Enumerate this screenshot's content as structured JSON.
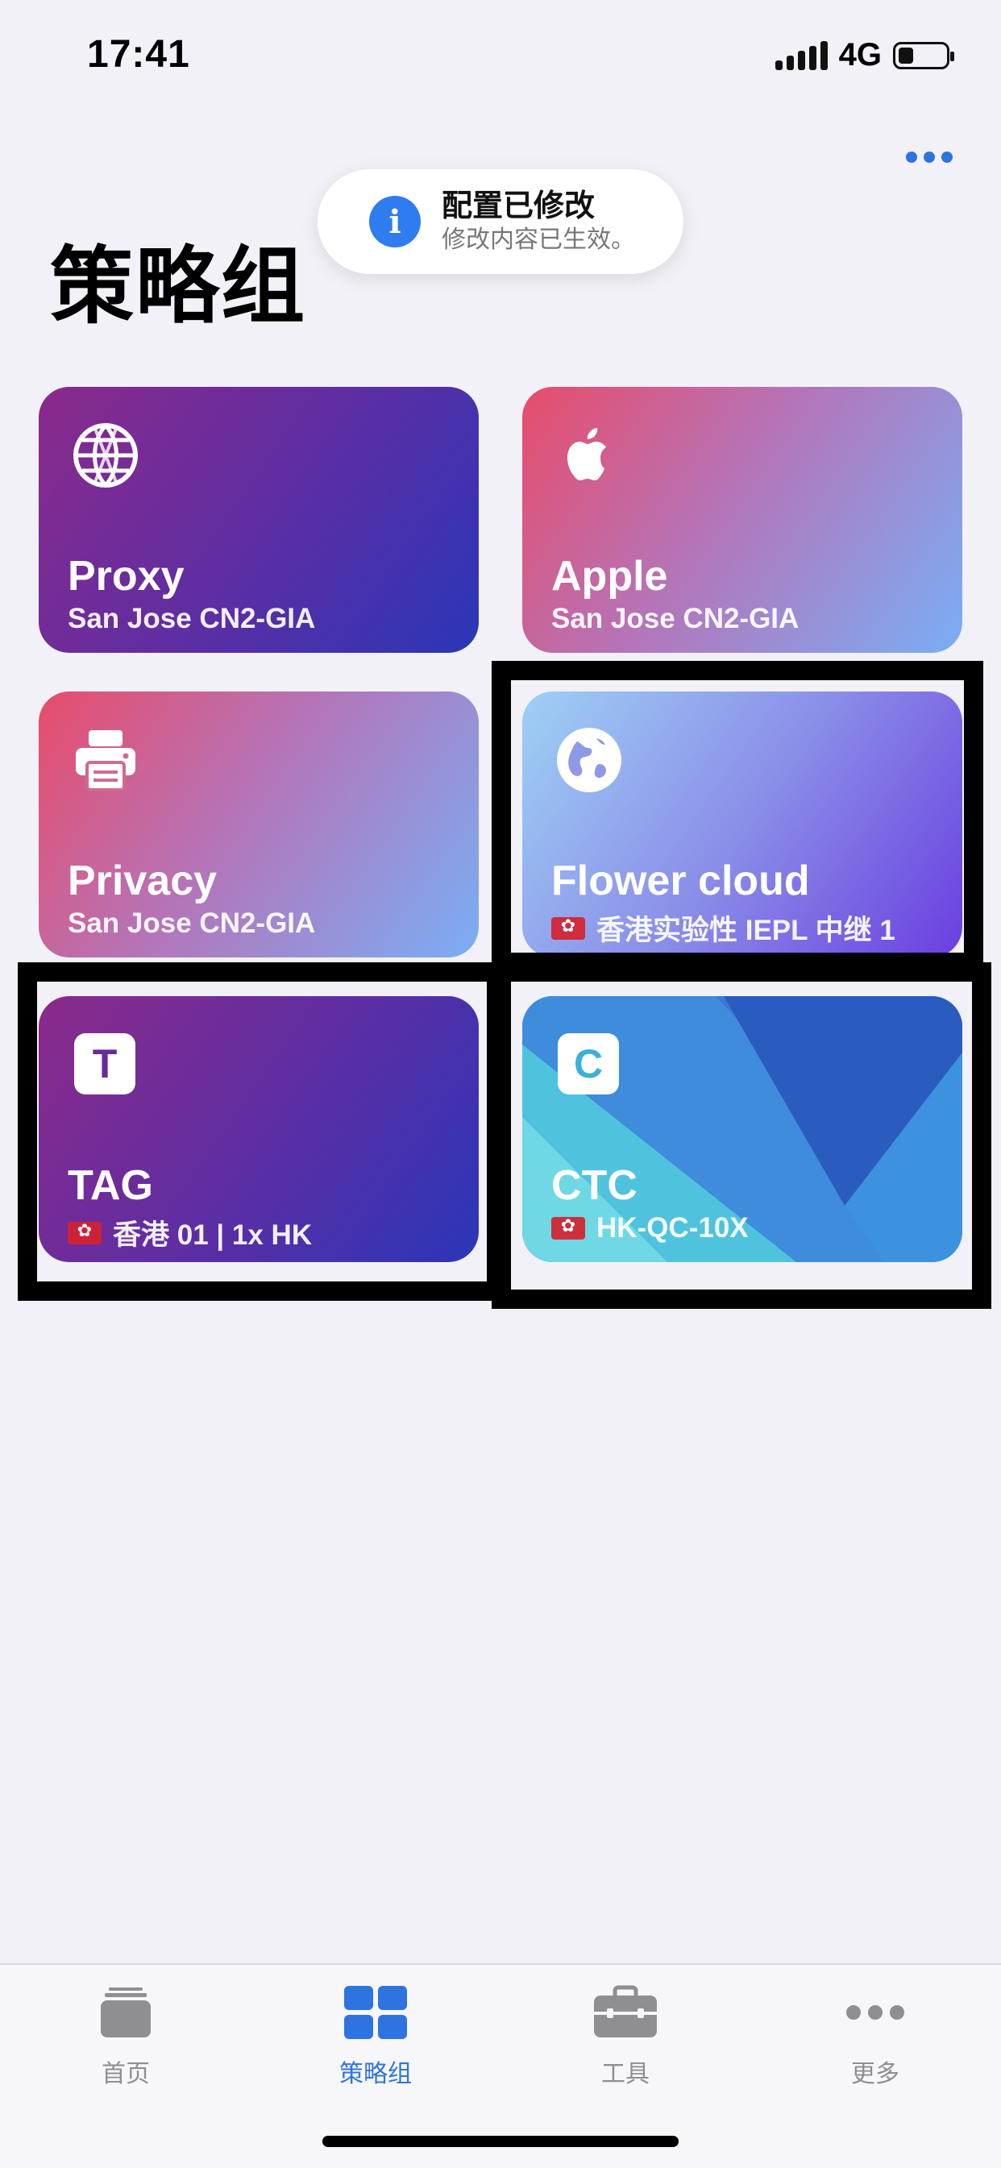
{
  "status_bar": {
    "time": "17:41",
    "network": "4G"
  },
  "toast": {
    "title": "配置已修改",
    "subtitle": "修改内容已生效。"
  },
  "page_title": "策略组",
  "cards": [
    {
      "name": "Proxy",
      "subtitle": "San Jose CN2-GIA",
      "icon": "globe-grid-icon"
    },
    {
      "name": "Apple",
      "subtitle": "San Jose CN2-GIA",
      "icon": "apple-logo-icon"
    },
    {
      "name": "Privacy",
      "subtitle": "San Jose CN2-GIA",
      "icon": "printer-icon"
    },
    {
      "name": "Flower cloud",
      "subtitle": "香港实验性 IEPL 中继 1",
      "icon": "earth-icon",
      "flag": "hong-kong-flag-icon"
    },
    {
      "name": "TAG",
      "subtitle": "香港 01 | 1x HK",
      "icon_letter": "T",
      "flag": "hong-kong-flag-icon"
    },
    {
      "name": "CTC",
      "subtitle": "HK-QC-10X",
      "icon_letter": "C",
      "flag": "hong-kong-flag-icon"
    }
  ],
  "tabs": [
    {
      "label": "首页",
      "icon": "stack-icon"
    },
    {
      "label": "策略组",
      "icon": "grid-icon",
      "active": true
    },
    {
      "label": "工具",
      "icon": "toolbox-icon"
    },
    {
      "label": "更多",
      "icon": "ellipsis-icon"
    }
  ],
  "colors": {
    "accent": "#2f73e0",
    "background": "#f2f1f7"
  }
}
